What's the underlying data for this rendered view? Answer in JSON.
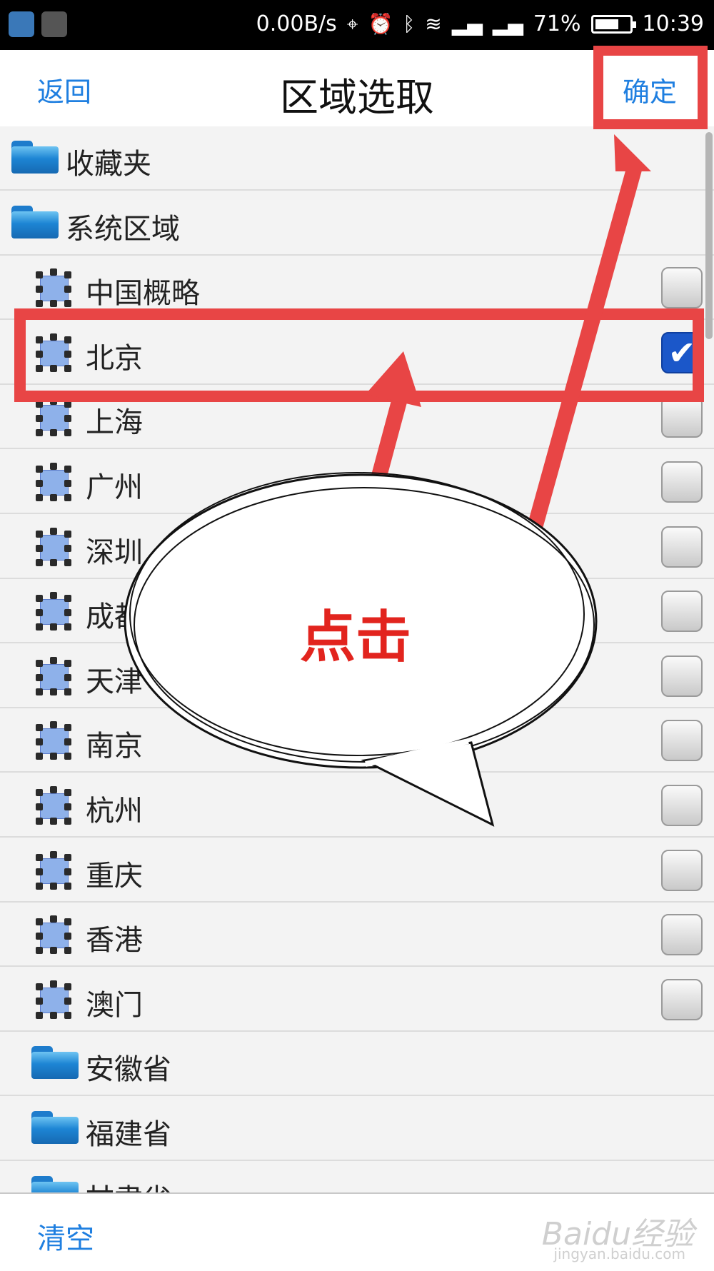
{
  "status_bar": {
    "network_speed": "0.00B/s",
    "battery_percent": "71%",
    "battery_level": 0.71,
    "time": "10:39",
    "icons": [
      "location-icon",
      "alarm-icon",
      "bluetooth-icon",
      "wifi-icon",
      "signal-icon",
      "signal-icon",
      "battery-icon"
    ]
  },
  "nav": {
    "back_label": "返回",
    "title": "区域选取",
    "confirm_label": "确定"
  },
  "list": {
    "rows": [
      {
        "type": "folder",
        "label": "收藏夹"
      },
      {
        "type": "folder",
        "label": "系统区域"
      },
      {
        "type": "region",
        "label": "中国概略",
        "checked": false
      },
      {
        "type": "region",
        "label": "北京",
        "checked": true
      },
      {
        "type": "region",
        "label": "上海",
        "checked": false
      },
      {
        "type": "region",
        "label": "广州",
        "checked": false
      },
      {
        "type": "region",
        "label": "深圳",
        "checked": false
      },
      {
        "type": "region",
        "label": "成都",
        "checked": false
      },
      {
        "type": "region",
        "label": "天津",
        "checked": false
      },
      {
        "type": "region",
        "label": "南京",
        "checked": false
      },
      {
        "type": "region",
        "label": "杭州",
        "checked": false
      },
      {
        "type": "region",
        "label": "重庆",
        "checked": false
      },
      {
        "type": "region",
        "label": "香港",
        "checked": false
      },
      {
        "type": "region",
        "label": "澳门",
        "checked": false
      },
      {
        "type": "subfolder",
        "label": "安徽省"
      },
      {
        "type": "subfolder",
        "label": "福建省"
      },
      {
        "type": "subfolder",
        "label": "甘肃省"
      }
    ]
  },
  "bottom": {
    "clear_label": "清空",
    "watermark": "Baidu经验",
    "watermark_sub": "jingyan.baidu.com"
  },
  "annotation": {
    "callout_text": "点击",
    "highlight_color": "#e84545"
  }
}
